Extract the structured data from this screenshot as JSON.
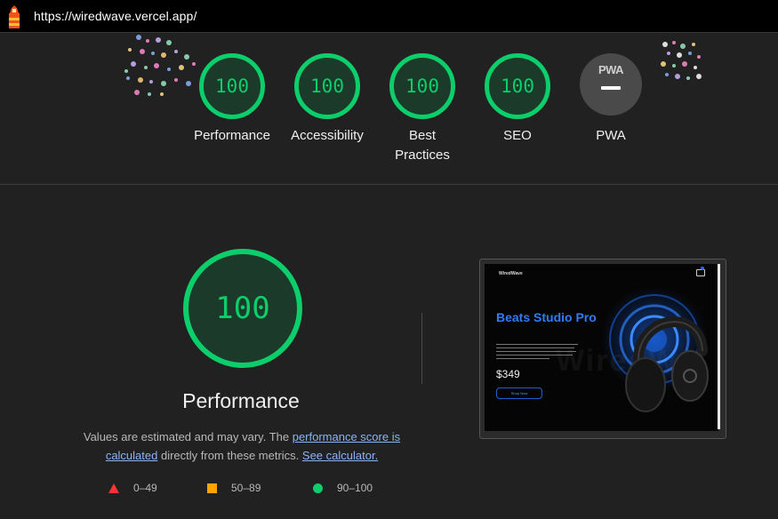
{
  "browser": {
    "url": "https://wiredwave.vercel.app/"
  },
  "categories": [
    {
      "id": "performance",
      "score": "100",
      "label": "Performance"
    },
    {
      "id": "accessibility",
      "score": "100",
      "label": "Accessibility"
    },
    {
      "id": "best-practices",
      "score": "100",
      "label": "Best Practices"
    },
    {
      "id": "seo",
      "score": "100",
      "label": "SEO"
    }
  ],
  "pwa": {
    "badge_text": "PWA",
    "label": "PWA"
  },
  "performance": {
    "score": "100",
    "title": "Performance",
    "desc_prefix": "Values are estimated and may vary. The ",
    "link_score": "performance score is calculated",
    "desc_middle": " directly from these metrics. ",
    "link_calc": "See calculator."
  },
  "legend": {
    "fail": "0–49",
    "average": "50–89",
    "pass": "90–100"
  },
  "thumbnail": {
    "logo": "WiredWave",
    "headline": "Beats Studio Pro",
    "price": "$349",
    "button": "Shop Now"
  },
  "colors": {
    "pass": "#0cce6b",
    "average": "#ffa400",
    "fail": "#ff3333",
    "link": "#8ab4f8",
    "brand_blue": "#2f7cf6"
  }
}
